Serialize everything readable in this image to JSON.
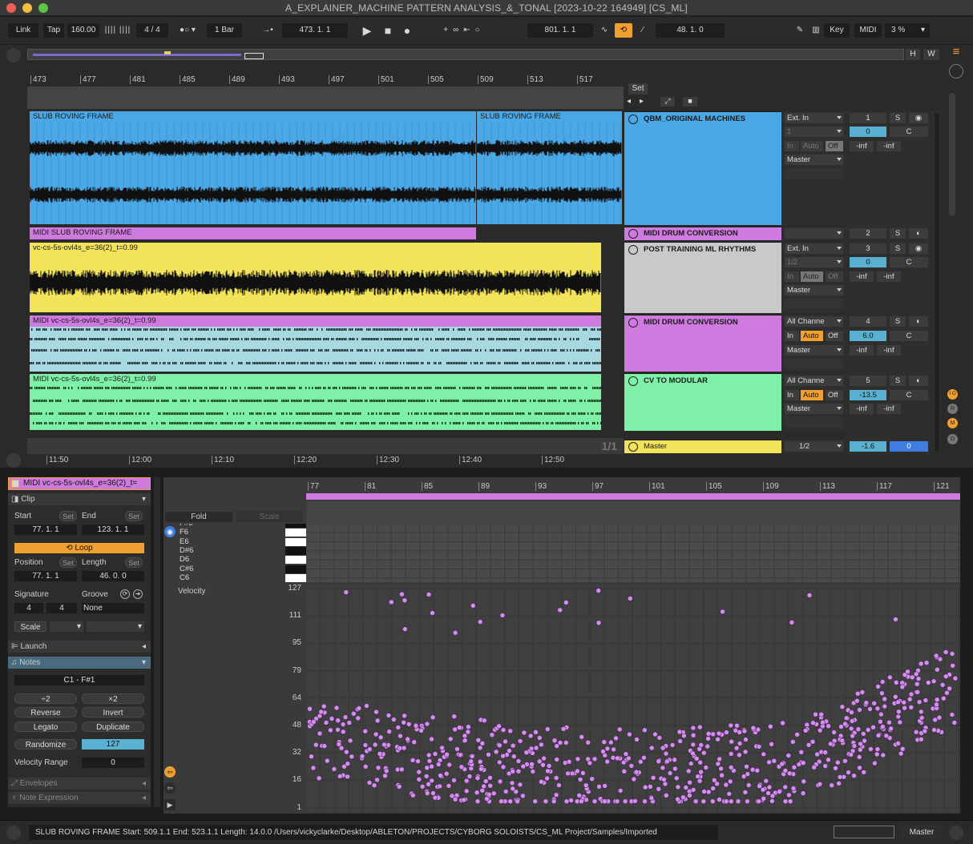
{
  "window": {
    "title": "A_EXPLAINER_MACHINE PATTERN ANALYSIS_&_TONAL [2023-10-22 164949]  [CS_ML]"
  },
  "control_bar": {
    "link": "Link",
    "tap": "Tap",
    "tempo": "160.00",
    "signature": "4 / 4",
    "quantize": "1 Bar",
    "arrangement_position": "473.   1.   1",
    "loop_start": "801.   1.   1",
    "loop_length": "48.   1.   0",
    "key": "Key",
    "midi": "MIDI",
    "cpu": "3 %"
  },
  "overview": {
    "h": "H",
    "w": "W"
  },
  "arrangement": {
    "bar_ticks": [
      "473",
      "477",
      "481",
      "485",
      "489",
      "493",
      "497",
      "501",
      "505",
      "509",
      "513",
      "517"
    ],
    "time_ticks": [
      "11:50",
      "12:00",
      "12:10",
      "12:20",
      "12:30",
      "12:40",
      "12:50"
    ],
    "set_label": "Set",
    "clips": [
      {
        "label": "SLUB ROVING FRAME"
      },
      {
        "label": "SLUB ROVING FRAME"
      },
      {
        "label": "MIDI SLUB ROVING FRAME"
      },
      {
        "label": "vc-cs-5s-ovl4s_e=36(2)_t=0.99"
      },
      {
        "label": "MIDI vc-cs-5s-ovl4s_e=36(2)_t=0.99"
      },
      {
        "label": "MIDI vc-cs-5s-ovl4s_e=36(2)_t=0.99"
      }
    ],
    "loop_counter": "1/1"
  },
  "tracks": [
    {
      "name": "QBM_ORIGINAL MACHINES",
      "input": "Ext. In",
      "channel": "1",
      "monitor": [
        "In",
        "Auto",
        "Off"
      ],
      "output": "Master",
      "number": "1",
      "solo": "S",
      "vol": "0",
      "pan": "C",
      "sendA": "-inf",
      "sendB": "-inf"
    },
    {
      "name": "MIDI DRUM CONVERSION",
      "number": "2",
      "solo": "S"
    },
    {
      "name": "POST TRAINING ML RHYTHMS",
      "input": "Ext. In",
      "channel": "1/2",
      "monitor": [
        "In",
        "Auto",
        "Off"
      ],
      "output": "Master",
      "number": "3",
      "solo": "S",
      "vol": "0",
      "pan": "C",
      "sendA": "-inf",
      "sendB": "-inf"
    },
    {
      "name": "MIDI DRUM CONVERSION",
      "input": "All Channe",
      "monitor": [
        "In",
        "Auto",
        "Off"
      ],
      "output": "Master",
      "number": "4",
      "solo": "S",
      "vol": "6.0",
      "pan": "C",
      "sendA": "-inf",
      "sendB": "-inf"
    },
    {
      "name": "CV TO MODULAR",
      "input": "All Channe",
      "monitor": [
        "In",
        "Auto",
        "Off"
      ],
      "output": "Master",
      "number": "5",
      "solo": "S",
      "vol": "-13.5",
      "pan": "C",
      "sendA": "-inf",
      "sendB": "-inf"
    },
    {
      "name": "Master",
      "channel": "1/2",
      "vol": "-1.6",
      "pan": "0"
    }
  ],
  "clip_view": {
    "clip_name": "MIDI vc-cs-5s-ovl4s_e=36(2)_t=",
    "clip_section": "Clip",
    "start_label": "Start",
    "end_label": "End",
    "set": "Set",
    "start_value": "77.   1.   1",
    "end_value": "123.   1.   1",
    "loop": "Loop",
    "position_label": "Position",
    "length_label": "Length",
    "position_value": "77.   1.   1",
    "length_value": "46.   0.   0",
    "signature_label": "Signature",
    "groove_label": "Groove",
    "sig_num": "4",
    "sig_den": "4",
    "groove_value": "None",
    "scale": "Scale",
    "launch": "Launch",
    "notes": "Notes",
    "pitch_range": "C1 - F#1",
    "div2": "÷2",
    "mul2": "×2",
    "reverse": "Reverse",
    "invert": "Invert",
    "legato": "Legato",
    "duplicate": "Duplicate",
    "randomize": "Randomize",
    "randomize_value": "127",
    "velocity_range_label": "Velocity Range",
    "velocity_range_value": "0",
    "envelopes": "Envelopes",
    "note_expression": "Note Expression"
  },
  "piano_roll": {
    "bar_ticks": [
      "77",
      "81",
      "85",
      "89",
      "93",
      "97",
      "101",
      "105",
      "109",
      "113",
      "117",
      "121"
    ],
    "fold": "Fold",
    "scale": "Scale",
    "keys": [
      "F#6",
      "F6",
      "E6",
      "D#6",
      "D6",
      "C#6",
      "C6"
    ],
    "velocity_label": "Velocity",
    "velocity_ticks": [
      "127",
      "111",
      "95",
      "79",
      "64",
      "48",
      "32",
      "16",
      "1"
    ]
  },
  "status": {
    "text": "SLUB ROVING FRAME  Start: 509.1.1  End: 523.1.1  Length: 14.0.0  /Users/vickyclarke/Desktop/ABLETON/PROJECTS/CYBORG SOLOISTS/CS_ML Project/Samples/Imported",
    "master": "Master"
  },
  "colors": {
    "blue": "#4aa8e6",
    "purple": "#cf7adf",
    "yellow": "#f2e35a",
    "green": "#7ef0a8",
    "orange": "#f0a030",
    "teal": "#5ab0d0",
    "velocity_dot": "#d58ef0"
  }
}
